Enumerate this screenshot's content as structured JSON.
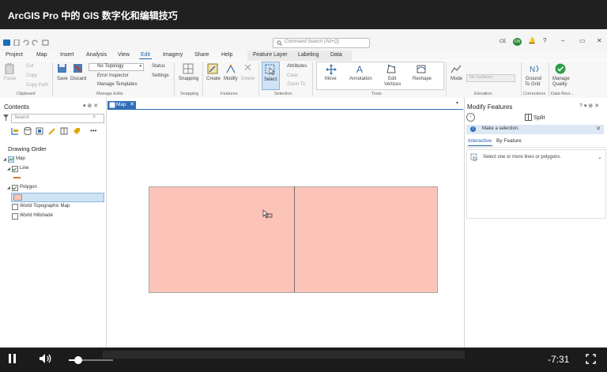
{
  "video": {
    "title": "ArcGIS Pro 中的 GIS 数字化和编辑技巧",
    "time_remaining": "-7:31",
    "progress_fraction": 0.21
  },
  "window": {
    "search_placeholder": "Command Search (Alt+Q)",
    "user_initials": "CE",
    "user_badge": "ON"
  },
  "ribbon": {
    "tabs": [
      "Project",
      "Map",
      "Insert",
      "Analysis",
      "View",
      "Edit",
      "Imagery",
      "Share",
      "Help"
    ],
    "active_tab": "Edit",
    "contextual_tabs": [
      "Feature Layer",
      "Labeling",
      "Data"
    ],
    "clipboard": {
      "paste": "Paste",
      "cut": "Cut",
      "copy": "Copy",
      "copy_path": "Copy Path",
      "group": "Clipboard"
    },
    "manage_edits": {
      "save": "Save",
      "discard": "Discard",
      "topology": "No Topology",
      "error_inspector": "Error Inspector",
      "manage_templates": "Manage Templates",
      "status": "Status",
      "settings": "Settings",
      "group": "Manage Edits"
    },
    "snapping": {
      "label": "Snapping",
      "group": "Snapping"
    },
    "features": {
      "create": "Create",
      "modify": "Modify",
      "delete": "Delete",
      "group": "Features"
    },
    "selection": {
      "select": "Select",
      "attributes": "Attributes",
      "clear": "Clear",
      "zoom_to": "Zoom To",
      "group": "Selection"
    },
    "tools": {
      "move": "Move",
      "annotation": "Annotation",
      "edit_vertices_1": "Edit",
      "edit_vertices_2": "Vertices",
      "reshape": "Reshape",
      "group": "Tools"
    },
    "elevation": {
      "mode": "Mode",
      "no_surfaces": "No surfaces",
      "group": "Elevation"
    },
    "corrections": {
      "ground_1": "Ground",
      "ground_2": "To Grid",
      "group": "Corrections"
    },
    "data_reviewer": {
      "label_1": "Manage",
      "label_2": "Quality",
      "group": "Data Revi..."
    }
  },
  "contents": {
    "title": "Contents",
    "search_placeholder": "Search",
    "section_title": "Drawing Order",
    "layers": [
      {
        "name": "Map"
      },
      {
        "name": "Line"
      },
      {
        "name": "Polygon"
      },
      {
        "name": "World Topographic Map"
      },
      {
        "name": "World Hillshade"
      }
    ]
  },
  "map": {
    "tab_label": "Map",
    "polygon_fill": "#fcc4b9",
    "line_color": "#e07040"
  },
  "modify_features": {
    "title": "Modify Features",
    "tool": "Split",
    "message": "Make a selection.",
    "tabs": [
      "Interactive",
      "By Feature"
    ],
    "active_tab": "Interactive",
    "instruction": "Select one or more lines or polygons."
  },
  "colors": {
    "accent": "#1e62b0",
    "player_bg": "#1b1b1b",
    "title_bg": "#202020"
  }
}
